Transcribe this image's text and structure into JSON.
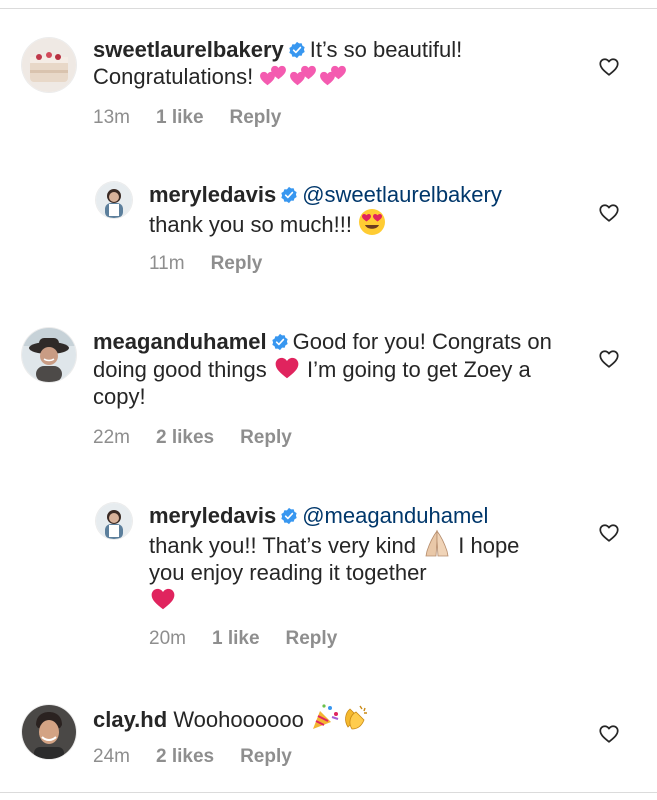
{
  "comments": [
    {
      "username": "sweetlaurelbakery",
      "text": "It’s so beautiful! Congratulations!",
      "time": "13m",
      "likes": "1 like",
      "reply": "Reply"
    },
    {
      "username": "meryledavis",
      "mention": "@sweetlaurelbakery",
      "text": "thank you so much!!!",
      "time": "11m",
      "reply": "Reply"
    },
    {
      "username": "meaganduhamel",
      "text_a": "Good for you! Congrats on doing good things",
      "text_b": "I’m going to get Zoey a copy!",
      "time": "22m",
      "likes": "2 likes",
      "reply": "Reply"
    },
    {
      "username": "meryledavis",
      "mention": "@meaganduhamel",
      "text_a": "thank you!! That’s very kind",
      "text_b": "I hope you enjoy reading it together",
      "time": "20m",
      "likes": "1 like",
      "reply": "Reply"
    },
    {
      "username": "clay.hd",
      "text": "Woohoooooo",
      "time": "24m",
      "likes": "2 likes",
      "reply": "Reply"
    }
  ],
  "colors": {
    "verified": "#3897f0",
    "mention": "#00376b",
    "meta": "#8e8e8e",
    "text": "#262626",
    "heart_emoji": "#e0245e"
  },
  "icons": [
    "verified-badge-icon",
    "heart-outline-icon",
    "two-hearts-emoji",
    "heart-eyes-emoji",
    "red-heart-emoji",
    "folded-hands-emoji",
    "party-popper-emoji",
    "clapping-hands-emoji"
  ]
}
